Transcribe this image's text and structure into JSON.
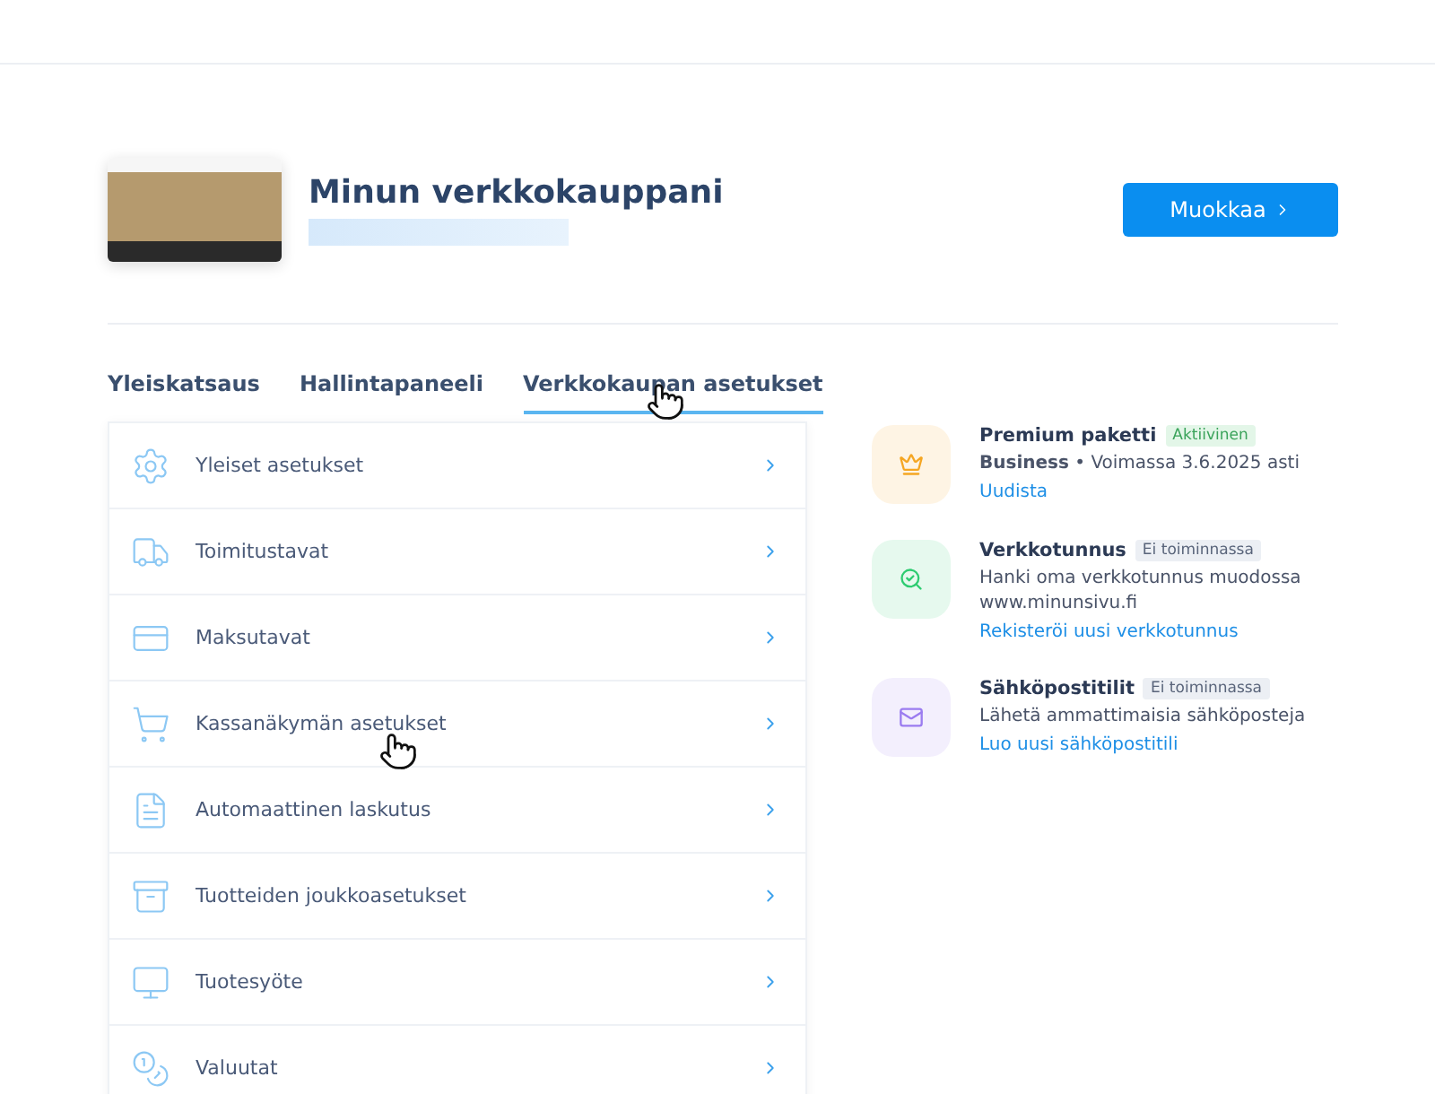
{
  "site": {
    "title": "Minun verkkokauppani",
    "edit_button": "Muokkaa"
  },
  "tabs": [
    {
      "label": "Yleiskatsaus",
      "selected": false
    },
    {
      "label": "Hallintapaneeli",
      "selected": false
    },
    {
      "label": "Verkkokaupan asetukset",
      "selected": true
    }
  ],
  "settings": [
    {
      "kind": "gears",
      "label": "Yleiset asetukset"
    },
    {
      "kind": "truck",
      "label": "Toimitustavat"
    },
    {
      "kind": "card",
      "label": "Maksutavat"
    },
    {
      "kind": "cart",
      "label": "Kassanäkymän asetukset"
    },
    {
      "kind": "invoice",
      "label": "Automaattinen laskutus"
    },
    {
      "kind": "box",
      "label": "Tuotteiden joukkoasetukset"
    },
    {
      "kind": "feed",
      "label": "Tuotesyöte"
    },
    {
      "kind": "coins",
      "label": "Valuutat"
    }
  ],
  "services": [
    {
      "kind": "crown",
      "color": "#f5a623",
      "name": "Premium paketti",
      "status": "Aktiivinen",
      "active": true,
      "description": "**Business** • Voimassa 3.6.2025 asti",
      "link": "Uudista"
    },
    {
      "kind": "domain",
      "color": "#2ecc71",
      "name": "Verkkotunnus",
      "status": "Ei toiminnassa",
      "active": false,
      "description": "Hanki oma verkkotunnus muodossa www.minunsivu.fi",
      "link": "Rekisteröi uusi verkkotunnus"
    },
    {
      "kind": "mail",
      "color": "#9b7cf0",
      "name": "Sähköpostitilit",
      "status": "Ei toiminnassa",
      "active": false,
      "description": "Lähetä ammattimaisia sähköposteja",
      "link": "Luo uusi sähköpostitili"
    }
  ]
}
